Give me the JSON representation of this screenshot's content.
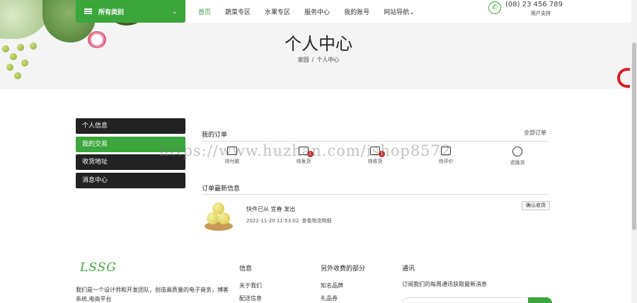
{
  "nav": {
    "categories_label": "所有类别",
    "items": [
      {
        "label": "首页",
        "active": true
      },
      {
        "label": "蔬菜专区"
      },
      {
        "label": "水果专区"
      },
      {
        "label": "服务中心"
      },
      {
        "label": "我的账号"
      },
      {
        "label": "网站导航"
      }
    ],
    "phone": "(08) 23 456 789",
    "support_label": "用户支持"
  },
  "hero": {
    "title": "个人中心",
    "breadcrumb": [
      "家园",
      "个人中心"
    ]
  },
  "sidebar": {
    "items": [
      {
        "label": "个人信息"
      },
      {
        "label": "我的交易",
        "active": true
      },
      {
        "label": "收货地址"
      },
      {
        "label": "消息中心"
      }
    ]
  },
  "orders": {
    "title": "我的订单",
    "all_link": "全部订单",
    "statuses": [
      {
        "label": "待付款",
        "icon": "wallet-icon"
      },
      {
        "label": "待发货",
        "icon": "package-icon",
        "badge": "1"
      },
      {
        "label": "待收货",
        "icon": "truck-icon",
        "badge": "1"
      },
      {
        "label": "待评价",
        "icon": "comment-icon"
      },
      {
        "label": "退换货",
        "icon": "return-icon"
      }
    ]
  },
  "updates": {
    "title": "订单最新信息",
    "message": "快件已从 宜春 发出",
    "time": "2022-11-20 11:53:02",
    "track_link": "查看物流明细",
    "confirm_button": "确认收货"
  },
  "footer": {
    "logo": "LSSG",
    "about": "我们是一个设计师和开发团队，创造高质量的电子商务，博客系统,电商平台",
    "col_info": {
      "title": "信息",
      "links": [
        "关于我们",
        "配送信息"
      ]
    },
    "col_extra": {
      "title": "另外收费的部分",
      "links": [
        "知名品牌",
        "礼品券"
      ]
    },
    "col_news": {
      "title": "通讯",
      "desc": "订阅我们的每周通讯获取最新消息"
    }
  },
  "watermark": "https://www.huzhan.com/ishop8572",
  "colors": {
    "accent": "#3aa63b",
    "dark": "#222222",
    "badge": "#c62828"
  }
}
